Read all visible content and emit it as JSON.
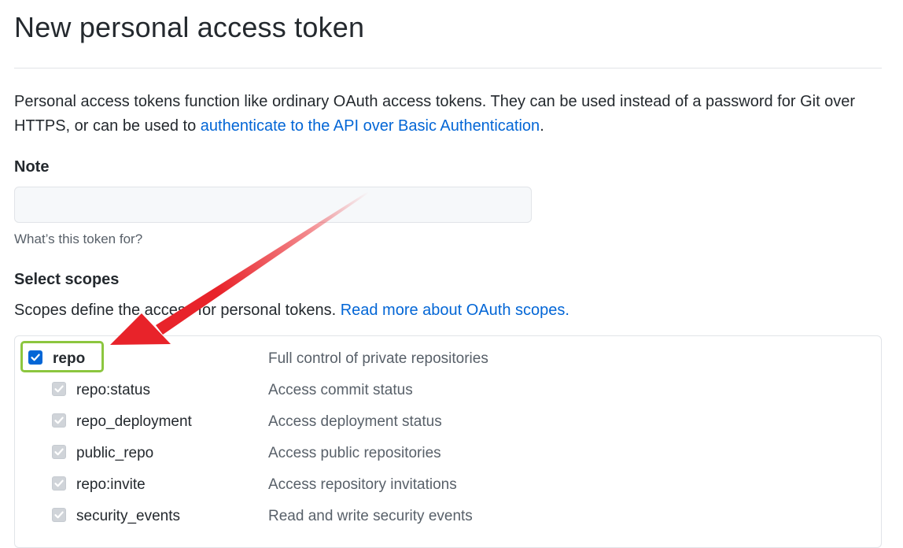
{
  "page": {
    "title": "New personal access token"
  },
  "intro": {
    "text": "Personal access tokens function like ordinary OAuth access tokens. They can be used instead of a password for Git over HTTPS, or can be used to ",
    "link": "authenticate to the API over Basic Authentication",
    "suffix": "."
  },
  "note": {
    "label": "Note",
    "value": "",
    "placeholder": "",
    "hint": "What’s this token for?"
  },
  "scopes": {
    "label": "Select scopes",
    "description": "Scopes define the access for personal tokens. ",
    "link": "Read more about OAuth scopes.",
    "items": [
      {
        "name": "repo",
        "description": "Full control of private repositories",
        "checked": true
      },
      {
        "name": "repo:status",
        "description": "Access commit status",
        "checked": true
      },
      {
        "name": "repo_deployment",
        "description": "Access deployment status",
        "checked": true
      },
      {
        "name": "public_repo",
        "description": "Access public repositories",
        "checked": true
      },
      {
        "name": "repo:invite",
        "description": "Access repository invitations",
        "checked": true
      },
      {
        "name": "security_events",
        "description": "Read and write security events",
        "checked": true
      }
    ]
  },
  "annotation": {
    "arrow_color": "#e8232a",
    "highlight_color": "#8cc63f"
  }
}
